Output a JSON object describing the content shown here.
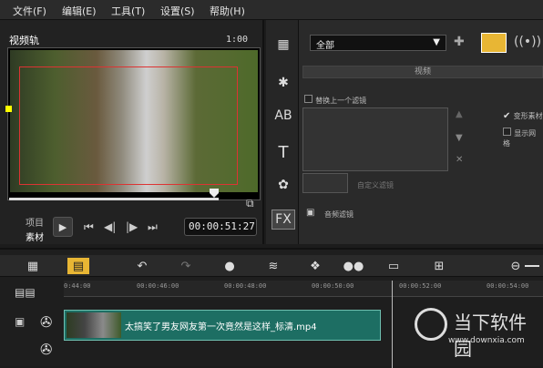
{
  "menu": [
    "文件(F)",
    "编辑(E)",
    "工具(T)",
    "设置(S)",
    "帮助(H)"
  ],
  "preview": {
    "track_label": "视频轨",
    "overlay_timecode": "1:00",
    "mode_project": "项目",
    "mode_clip": "素材",
    "timecode": "00:00:51:27"
  },
  "library": {
    "category": "全部",
    "video_tab": "视频",
    "replace_label": "替换上一个滤镜",
    "custom_filter": "自定义滤镜",
    "audio_filter": "音频滤镜",
    "deform_label": "变形素材",
    "show_grid": "显示网格"
  },
  "timeline": {
    "ruler": [
      "0:44:00",
      "00:00:46:00",
      "00:00:48:00",
      "00:00:50:00",
      "00:00:52:00",
      "00:00:54:00"
    ],
    "clip_title": "太搞笑了男友网友第一次竟然是这样_标清.mp4"
  },
  "watermark": {
    "brand": "当下软件园",
    "url": "www.downxia.com"
  },
  "colors": {
    "clip": "#1d6e63",
    "accent_tab": "#e8b634"
  }
}
